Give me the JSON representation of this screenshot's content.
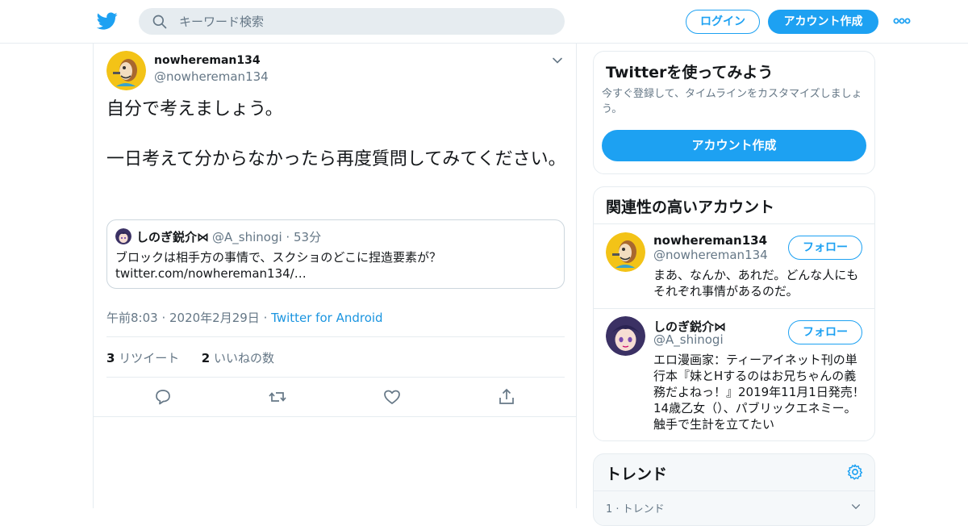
{
  "header": {
    "logo_icon": "twitter-bird-icon",
    "search": {
      "placeholder": "キーワード検索",
      "icon": "search-icon"
    },
    "login_label": "ログイン",
    "signup_label": "アカウント作成",
    "more_icon": "more-dots-icon",
    "accent": "#1da1f2"
  },
  "tweet": {
    "author_name": "nowhereman134",
    "author_handle": "@nowhereman134",
    "text": "自分で考えましょう。\n\n一日考えて分からなかったら再度質問してみてください。",
    "quote": {
      "name": "しのぎ鋭介⋈",
      "handle": "@A_shinogi",
      "separator": "·",
      "time": "53分",
      "text": "ブロックは相手方の事情で、スクショのどこに捏造要素が？\ntwitter.com/nowhereman134/…"
    },
    "meta": {
      "time": "午前8:03 · 2020年2月29日",
      "separator": "·",
      "source": "Twitter for Android"
    },
    "stats": {
      "retweets_count": "3",
      "retweets_label": "リツイート",
      "likes_count": "2",
      "likes_label": "いいねの数"
    },
    "actions": [
      "reply-icon",
      "retweet-icon",
      "like-icon",
      "share-icon"
    ]
  },
  "sidebar": {
    "signup_card": {
      "title": "Twitterを使ってみよう",
      "description": "今すぐ登録して、タイムラインをカスタマイズしましょう。",
      "button": "アカウント作成"
    },
    "related": {
      "title": "関連性の高いアカウント",
      "accounts": [
        {
          "name": "nowhereman134",
          "handle": "@nowhereman134",
          "follow": "フォロー",
          "bio": "まあ、なんか、あれだ。どんな人にもそれぞれ事情があるのだ。"
        },
        {
          "name": "しのぎ鋭介⋈",
          "handle": "@A_shinogi",
          "follow": "フォロー",
          "bio": "エロ漫画家：ティーアイネット刊の単行本『妹とHするのはお兄ちゃんの義務だよねっ！』2019年11月1日発売！14歳乙女（）、パブリックエネミー。触手で生計を立てたい"
        }
      ]
    },
    "trends": {
      "title": "トレンド",
      "first_row": "1 · トレンド"
    }
  }
}
